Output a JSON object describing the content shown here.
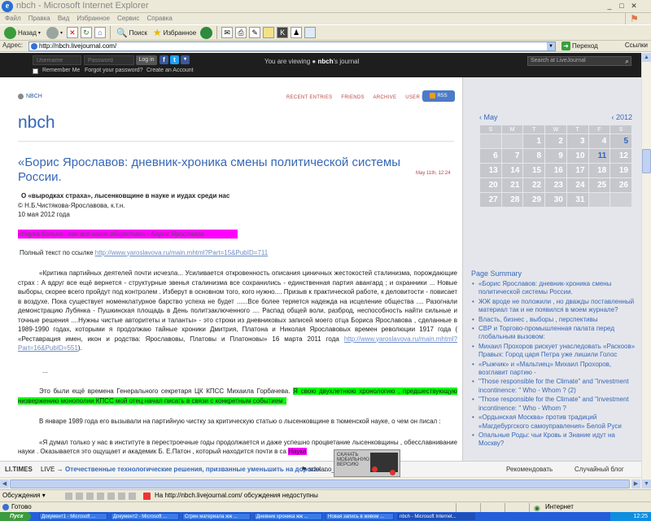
{
  "window": {
    "title": "nbch - Microsoft Internet Explorer",
    "menu": [
      "Файл",
      "Правка",
      "Вид",
      "Избранное",
      "Сервис",
      "Справка"
    ]
  },
  "toolbar": {
    "back_label": "Назад",
    "search_label": "Поиск",
    "favorites_label": "Избранное"
  },
  "address": {
    "label": "Адрес:",
    "url": "http://nbch.livejournal.com/",
    "go_label": "Переход",
    "links_label": "Ссылки"
  },
  "lj": {
    "username_placeholder": "Username",
    "password_placeholder": "Password",
    "login_label": "Log in",
    "remember_label": "Remember Me",
    "forgot_label": "Forgot your password?",
    "create_label": "Create an Account",
    "viewing_prefix": "You are viewing",
    "viewing_user": "nbch",
    "viewing_suffix": "'s journal",
    "search_placeholder": "Search at LiveJournal"
  },
  "blog": {
    "user_link": "NBCH",
    "title": "nbch",
    "nav": [
      "RECENT ENTRIES",
      "FRIENDS",
      "ARCHIVE",
      "USER INFO"
    ],
    "rss_label": "RSS"
  },
  "post": {
    "title": "«Борис Ярославов: дневник-хроника смены политической системы России.",
    "date": "May 11th, 12:24",
    "subtitle": "О «выродках страха»,   лысенковщине в  науке и иудах среди  нас",
    "author": "© Н.Б.Чистякова-Ярославова, к.т.н.",
    "date_line": "10 мая   2012 года",
    "quote": "«Наука больна , как  все наше  общество» - Борис   Ярославов",
    "full_text_prefix": "Полный  текст  по ссылке",
    "full_text_url": "http://www.yaroslavova.ru/main.mhtml?Part=15&PubID=711",
    "p1_text": "«Критика     партийных  деятелей      почти  исчезла... Усиливается откровенность    описания  циничных  жестокостей  сталинизма, порождающие страх : А вдруг все ещё вернется - структурные звенья сталинизма все сохранились - единственная партия авангард ; и охранники ... Новые выборы, скорее всего пройдут под контролем .  Изберут в  основном того, кого нужно....   Призыв к практической работе, к деловитости - повисает в воздухе.   Пока  существует номенклатурное барство  успеха не будет ......Все более теряется  надежда на исцеление  общества .... Разогнали демонстрацию Лубянка - Пушкинская  площадь в  День политзаключенного .... Распад общей воли, разброд, неспособность  найти    сильные и точные  решения ....Нужны  чистые  авторитеты и таланты» -  это строки  из дневниковых  записей моего  отца  Бориса  Ярославова , сделанные в   1989-1990  годах, которыми я   продолжаю тайные  хроники Дмитрия, Платона и Николая  Ярославовых   времен   революции 1917 года ( «Реставрация имен, икон и родства: Ярославовы, Платовы и Платоновы»  16 марта 2011 года",
    "p1_url": "http://www.yaroslavova.ru/main.mhtml?Part=16&PubID=551",
    "p1_tail": ").",
    "dots": "...",
    "p2_text": "Это были ещё времена    Генерального секретаря   ЦК КПСС  Михаила  Горбачева.",
    "p2_hl": "Я свою          двухлетнюю хронологию , предшествующую      низвержению монополии КПСС  мой  отец     начал  писать  в  связи с  конкретным  событием .",
    "p3_text": "В январе 1989 года его вызывали на   партийную чистку   за    критическую   статью о лысенковщине в тюменской  науке, о чем он писал :",
    "p4_text": "«Я думал только у нас в институте в перестроечные годы  продолжается и даже  успешно   процветание   лысенковщины , обесславнивание науки . Оказывается это  ощущает и академик  Б. Е.Патон , который находится почти в са",
    "p4_hl": "Наука"
  },
  "calendar": {
    "month": "May",
    "year": "2012",
    "weekdays": [
      "S",
      "M",
      "T",
      "W",
      "T",
      "F",
      "S"
    ],
    "weeks": [
      [
        "",
        "",
        "1",
        "2",
        "3",
        "4",
        "5"
      ],
      [
        "6",
        "7",
        "8",
        "9",
        "10",
        "11",
        "12"
      ],
      [
        "13",
        "14",
        "15",
        "16",
        "17",
        "18",
        "19"
      ],
      [
        "20",
        "21",
        "22",
        "23",
        "24",
        "25",
        "26"
      ],
      [
        "27",
        "28",
        "29",
        "30",
        "31",
        "",
        ""
      ]
    ]
  },
  "page_summary": {
    "heading": "Page Summary",
    "items": [
      "«Борис Ярославов: дневник-хроника смены политической системы России.",
      "ЖЖ вроде не положили , но дважды поставленный материал так и не появился в моем журнале?",
      "Власть, бизнес , выборы , перспективы",
      "СВР и Торгово-промышленная палата перед глобальным вызовом:",
      "Михаил Прохоров рискует унаследовать «Раскоов» Правых: Город царя Петра уже лишили Голос",
      "«Рыжчик» и «Мальтиец» Михаил Прохоров, возглавит партию -",
      "\"Those responsible for the Climate\" and \"investment incontinence: \" Who - Whom ? (2)",
      "\"Those responsible for the Climate\" and \"investment incontinence: \" Who - Whom ?",
      "«Ордынская Москва» против традиций «Магдебургского самоуправления» Белой Руси",
      "Опальные Роды: чьи Кровь и Знание идут на Москву?"
    ]
  },
  "livebar": {
    "logo": "LI.TIMES",
    "live_label": "LIVE →",
    "headline": "Отечественные технологические решения, призванные уменьшить на дорогах ...",
    "source": "sdelano_u_n",
    "ad_text": "СКАЧАТЬ МОБИЛЬНУЮ ВЕРСИЮ",
    "recommend": "Рекомендовать",
    "random": "Случайный блог"
  },
  "discussion": {
    "label": "Обсуждения ▾",
    "status": "На http://nbch.livejournal.com/ обсуждения недоступны"
  },
  "status": {
    "ready": "Готово",
    "zone": "Интернет"
  },
  "taskbar": {
    "start": "Пуск",
    "tasks": [
      "Документ1 - Microsoft ...",
      "Документ2 - Microsoft ...",
      "Сгрин материала  жж ...",
      "Дневник  хроника жж ...",
      "Новая запись в живом ...",
      "nbch - Microsoft Internet..."
    ],
    "clock": "12:25"
  }
}
